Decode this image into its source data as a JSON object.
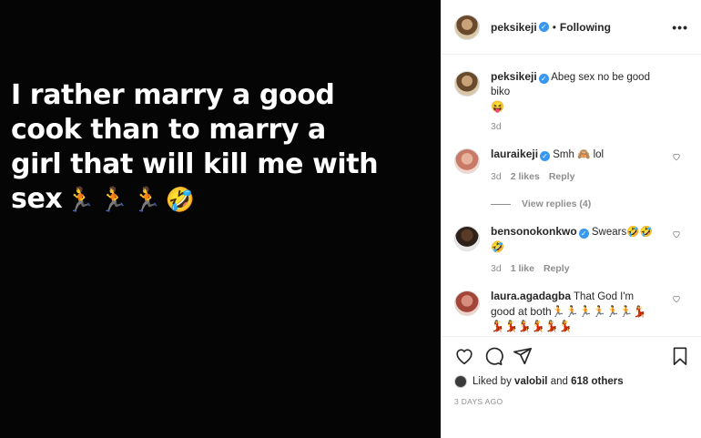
{
  "media": {
    "text_line1": "I rather marry a good",
    "text_line2": "cook than to marry a",
    "text_line3": "girl that will kill me with",
    "text_line4": "sex",
    "emojis": "🏃🏃🏃🤣"
  },
  "header": {
    "username": "peksikeji",
    "separator": "•",
    "follow_status": "Following",
    "more": "•••"
  },
  "caption": {
    "username": "peksikeji",
    "text": "Abeg sex no be good biko",
    "emoji": "😝",
    "time": "3d"
  },
  "comments": [
    {
      "username": "lauraikeji",
      "text": "Smh 🙈 lol",
      "time": "3d",
      "likes": "2 likes",
      "reply": "Reply",
      "view_replies": "View replies (4)"
    },
    {
      "username": "bensonokonkwo",
      "text": "Swears🤣🤣",
      "text2": "🤣",
      "time": "3d",
      "likes": "1 like",
      "reply": "Reply"
    },
    {
      "username": "laura.agadagba",
      "text": "That God I'm",
      "text2": "good at both🏃🏃🏃🏃🏃🏃💃",
      "text3": "💃💃💃💃💃💃"
    }
  ],
  "likes": {
    "prefix": "Liked by",
    "user": "valobil",
    "joiner": "and",
    "others": "618 others"
  },
  "post_date": "3 DAYS AGO",
  "icons": [
    "heart-icon",
    "comment-icon",
    "share-icon",
    "bookmark-icon"
  ],
  "colors": {
    "verified": "#3897f0",
    "muted": "#8e8e8e",
    "media_bg": "#050505"
  }
}
